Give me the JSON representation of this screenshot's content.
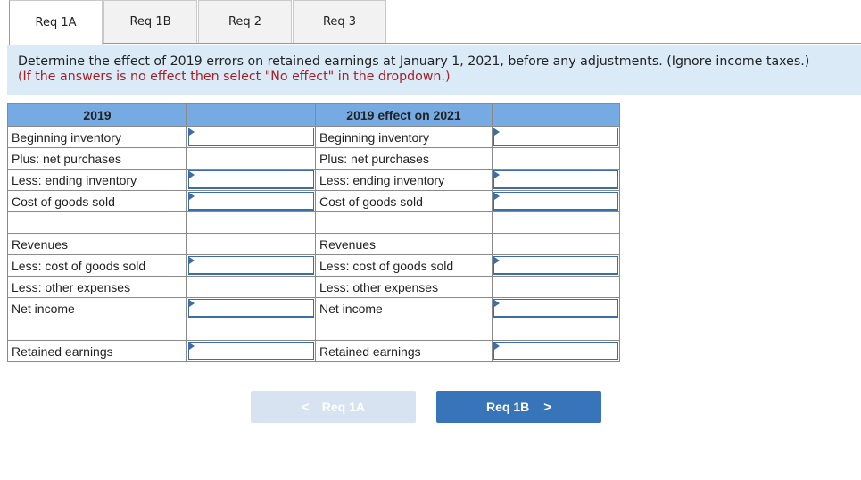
{
  "tabs": [
    {
      "label": "Req 1A",
      "active": true
    },
    {
      "label": "Req 1B",
      "active": false
    },
    {
      "label": "Req 2",
      "active": false
    },
    {
      "label": "Req 3",
      "active": false
    }
  ],
  "instructions": {
    "main": "Determine the effect of 2019 errors on retained earnings at January 1, 2021, before any adjustments. (Ignore income taxes.)",
    "note": "(If the answers is no effect then select \"No effect\" in the dropdown.)"
  },
  "table": {
    "headers": [
      "2019",
      "",
      "2019 effect on 2021",
      ""
    ],
    "rows": [
      {
        "left": "Beginning inventory",
        "left_input": true,
        "right": "Beginning inventory",
        "right_input": true
      },
      {
        "left": "Plus: net purchases",
        "left_input": false,
        "right": "Plus: net purchases",
        "right_input": false
      },
      {
        "left": "Less: ending inventory",
        "left_input": true,
        "right": "Less: ending inventory",
        "right_input": true
      },
      {
        "left": "Cost of goods sold",
        "left_input": true,
        "right": "Cost of goods sold",
        "right_input": true
      },
      {
        "left": "",
        "left_input": false,
        "right": "",
        "right_input": false
      },
      {
        "left": "Revenues",
        "left_input": false,
        "right": "Revenues",
        "right_input": false
      },
      {
        "left": "Less: cost of goods sold",
        "left_input": true,
        "right": "Less: cost of goods sold",
        "right_input": true
      },
      {
        "left": "Less: other expenses",
        "left_input": false,
        "right": "Less: other expenses",
        "right_input": false
      },
      {
        "left": "Net income",
        "left_input": true,
        "right": "Net income",
        "right_input": true
      },
      {
        "left": "",
        "left_input": false,
        "right": "",
        "right_input": false
      },
      {
        "left": "Retained earnings",
        "left_input": true,
        "right": "Retained earnings",
        "right_input": true
      }
    ]
  },
  "nav": {
    "prev_label": "Req 1A",
    "prev_icon": "chevron-left-icon",
    "prev_glyph": "<",
    "next_label": "Req 1B",
    "next_icon": "chevron-right-icon",
    "next_glyph": ">"
  }
}
